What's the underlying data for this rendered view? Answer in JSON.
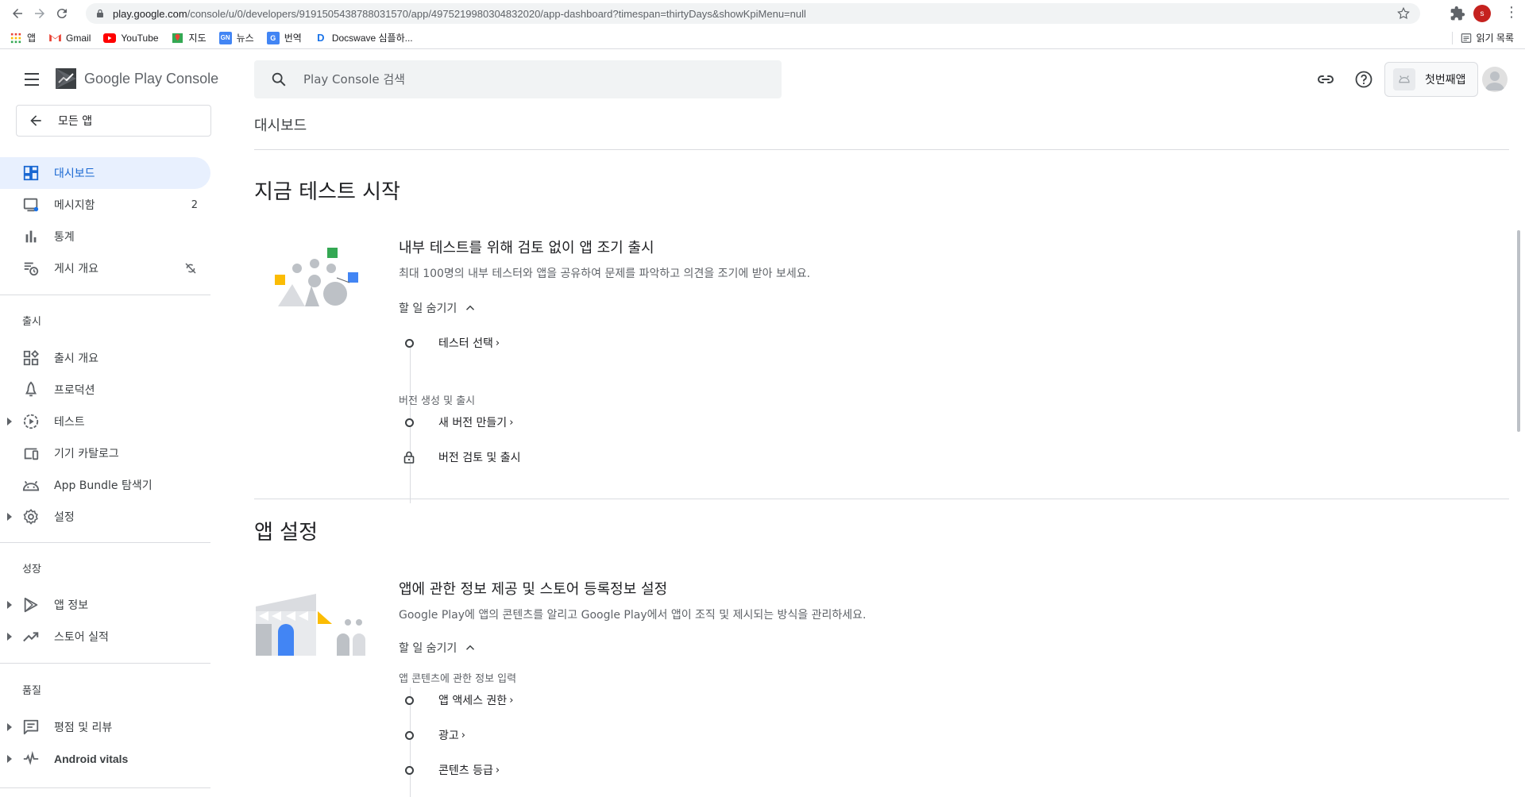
{
  "browser": {
    "url_host": "play.google.com",
    "url_path": "/console/u/0/developers/9191505438788031570/app/4975219980304832020/app-dashboard?timespan=thirtyDays&showKpiMenu=null",
    "profile_initial": "s",
    "bookmarks": [
      {
        "label": "앱",
        "icon": "apps-grid-icon",
        "color": "#ea4335"
      },
      {
        "label": "Gmail",
        "icon": "gmail-icon",
        "color": "#ea4335"
      },
      {
        "label": "YouTube",
        "icon": "youtube-icon",
        "color": "#ff0000"
      },
      {
        "label": "지도",
        "icon": "maps-icon",
        "color": "#34a853"
      },
      {
        "label": "뉴스",
        "icon": "news-icon",
        "color": "#4285f4"
      },
      {
        "label": "번역",
        "icon": "translate-icon",
        "color": "#4285f4"
      },
      {
        "label": "Docswave 심플하...",
        "icon": "docswave-icon",
        "color": "#1a73e8"
      }
    ],
    "reading_list": "읽기 목록"
  },
  "header": {
    "logo_text": "Google Play Console",
    "search_placeholder": "Play Console 검색",
    "app_name": "첫번째앱"
  },
  "sidebar": {
    "back_label": "모든 앱",
    "items_top": [
      {
        "label": "대시보드",
        "icon": "dashboard-icon",
        "active": true
      },
      {
        "label": "메시지함",
        "icon": "inbox-icon",
        "count": "2"
      },
      {
        "label": "통계",
        "icon": "bar-chart-icon"
      },
      {
        "label": "게시 개요",
        "icon": "publishing-overview-icon",
        "trail_icon": "sync-disabled-icon"
      }
    ],
    "section_release": "출시",
    "items_release": [
      {
        "label": "출시 개요",
        "icon": "release-overview-icon"
      },
      {
        "label": "프로덕션",
        "icon": "production-icon"
      },
      {
        "label": "테스트",
        "icon": "testing-icon",
        "expandable": true
      },
      {
        "label": "기기 카탈로그",
        "icon": "device-catalog-icon"
      },
      {
        "label": "App Bundle 탐색기",
        "icon": "android-icon"
      },
      {
        "label": "설정",
        "icon": "settings-gear-icon",
        "expandable": true
      }
    ],
    "section_growth": "성장",
    "items_growth": [
      {
        "label": "앱 정보",
        "icon": "play-store-icon",
        "expandable": true
      },
      {
        "label": "스토어 실적",
        "icon": "trending-up-icon",
        "expandable": true
      }
    ],
    "section_quality": "품질",
    "items_quality": [
      {
        "label": "평점 및 리뷰",
        "icon": "reviews-icon",
        "expandable": true
      },
      {
        "label": "Android vitals",
        "icon": "vitals-icon",
        "expandable": true
      }
    ]
  },
  "main": {
    "page_title": "대시보드",
    "section1": {
      "title": "지금 테스트 시작",
      "card_title": "내부 테스트를 위해 검토 없이 앱 조기 출시",
      "card_desc": "최대 100명의 내부 테스터와 앱을 공유하여 문제를 파악하고 의견을 조기에 받아 보세요.",
      "toggle_label": "할 일 숨기기",
      "task1": "테스터 선택",
      "group_label": "버전 생성 및 출시",
      "task2": "새 버전 만들기",
      "task3": "버전 검토 및 출시"
    },
    "section2": {
      "title": "앱 설정",
      "card_title": "앱에 관한 정보 제공 및 스토어 등록정보 설정",
      "card_desc": "Google Play에 앱의 콘텐츠를 알리고 Google Play에서 앱이 조직 및 제시되는 방식을 관리하세요.",
      "toggle_label": "할 일 숨기기",
      "group_label": "앱 콘텐츠에 관한 정보 입력",
      "task1": "앱 액세스 권한",
      "task2": "광고",
      "task3": "콘텐츠 등급"
    },
    "chevron": "›"
  },
  "colors": {
    "accent": "#1967d2",
    "active_bg": "#e8f0fe",
    "illus_green": "#34a853",
    "illus_yellow": "#fbbc04",
    "illus_blue": "#4285f4",
    "illus_gray": "#bdc1c6"
  }
}
